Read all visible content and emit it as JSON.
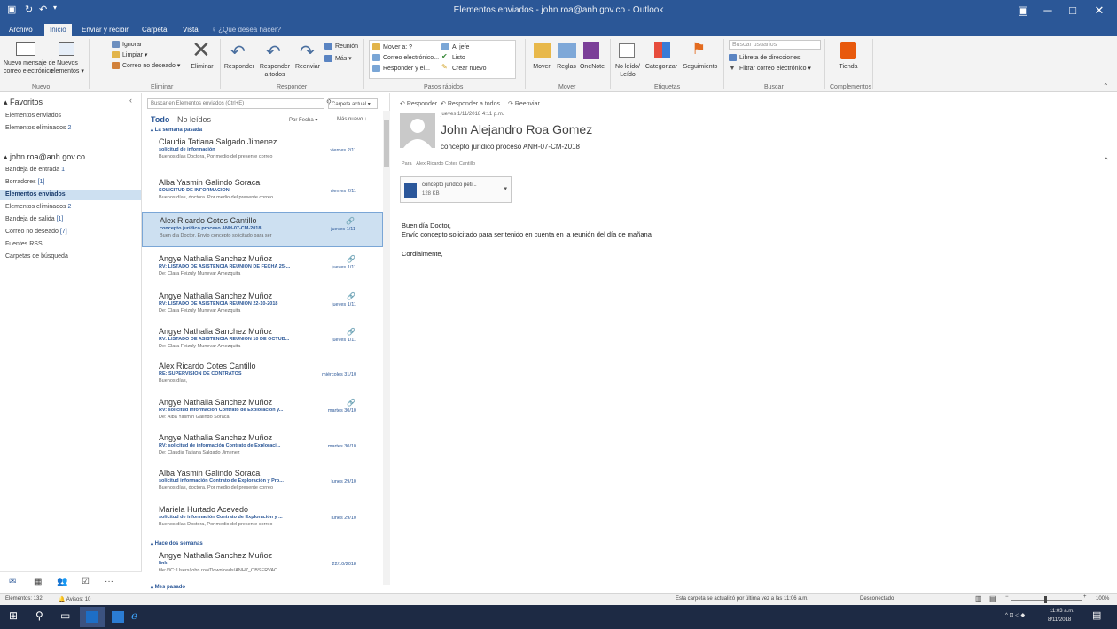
{
  "window": {
    "title": "Elementos enviados - john.roa@anh.gov.co - Outlook",
    "minimize": "─",
    "maximize": "□",
    "close": "✕",
    "restore_ribbon": "▣"
  },
  "ribbon_tabs": [
    "Archivo",
    "Inicio",
    "Enviar y recibir",
    "Carpeta",
    "Vista",
    "♀ ¿Qué desea hacer?"
  ],
  "ribbon": {
    "nuevo": {
      "new_mail": "Nuevo mensaje de\ncorreo electrónico",
      "new_items": "Nuevos\nelementos ▾",
      "group": "Nuevo"
    },
    "eliminar": {
      "ignore": "Ignorar",
      "clean": "Limpiar ▾",
      "junk": "Correo no deseado ▾",
      "delete": "Eliminar",
      "group": "Eliminar"
    },
    "responder": {
      "reply": "Responder",
      "reply_all": "Responder\na todos",
      "forward": "Reenviar",
      "meeting": "Reunión",
      "more": "Más ▾",
      "group": "Responder"
    },
    "pasos": {
      "move_to": "Mover a: ?",
      "to_boss": "Al jefe",
      "team": "Correo electrónico...",
      "done": "Listo",
      "reply_delete": "Responder y el...",
      "create_new": "Crear nuevo",
      "group": "Pasos rápidos"
    },
    "mover": {
      "move": "Mover",
      "rules": "Reglas",
      "onenote": "OneNote",
      "group": "Mover"
    },
    "etiquetas": {
      "unread": "No leído/\nLeído",
      "categorize": "Categorizar",
      "followup": "Seguimiento",
      "group": "Etiquetas"
    },
    "buscar": {
      "search_people": "Buscar usuarios",
      "address_book": "Libreta de direcciones",
      "filter": "Filtrar correo electrónico ▾",
      "group": "Buscar"
    },
    "complementos": {
      "store": "Tienda",
      "group": "Complementos"
    }
  },
  "folder_pane": {
    "favorites_header": "▴ Favoritos",
    "collapse": "‹",
    "favorites": [
      {
        "label": "Elementos enviados",
        "count": ""
      },
      {
        "label": "Elementos eliminados",
        "count": "2"
      }
    ],
    "account": "▴ john.roa@anh.gov.co",
    "folders": [
      {
        "label": "Bandeja de entrada",
        "count": "1"
      },
      {
        "label": "Borradores",
        "count": "[1]"
      },
      {
        "label": "Elementos enviados",
        "count": ""
      },
      {
        "label": "Elementos eliminados",
        "count": "2"
      },
      {
        "label": "Bandeja de salida",
        "count": "[1]"
      },
      {
        "label": "Correo no deseado",
        "count": "[7]"
      },
      {
        "label": "Fuentes RSS",
        "count": ""
      },
      {
        "label": "Carpetas de búsqueda",
        "count": ""
      }
    ]
  },
  "nav_bar": [
    "✉",
    "▦",
    "👥",
    "☑",
    "···"
  ],
  "mail_list": {
    "search_placeholder": "Buscar en Elementos enviados (Ctrl+E)",
    "search_scope": "Carpeta actual ▾",
    "filter_all": "Todo",
    "filter_unread": "No leídos",
    "sort_by": "Por Fecha ▾",
    "sort_order": "Más nuevo ↓",
    "groups": [
      "▴ La semana pasada",
      "▴ Hace dos semanas",
      "▴ Mes pasado"
    ],
    "items": [
      {
        "from": "Claudia Tatiana Salgado Jimenez",
        "subject": "solicitud de información",
        "preview": "Buenos días Doctora,  Por medio del presente correo",
        "date": "viernes 2/11",
        "clip": ""
      },
      {
        "from": "Alba Yasmin Galindo Soraca",
        "subject": "SOLICITUD DE INFORMACION",
        "preview": "Buenos días, doctora.  Por medio del presente correo",
        "date": "viernes 2/11",
        "clip": ""
      },
      {
        "from": "Alex Ricardo Cotes Cantillo",
        "subject": "concepto jurídico proceso ANH-07-CM-2018",
        "preview": "Buen día Doctor,  Envío concepto solicitado para ser",
        "date": "jueves 1/11",
        "clip": "🔗"
      },
      {
        "from": "Angye Nathalia Sanchez Muñoz",
        "subject": "RV: LISTADO DE ASISTENCIA REUNION DE FECHA 25-...",
        "preview": "De: Clara Feizuly Munevar Amezquita",
        "date": "jueves 1/11",
        "clip": "🔗"
      },
      {
        "from": "Angye Nathalia Sanchez Muñoz",
        "subject": "RV: LISTADO DE ASISTENCIA REUNION 22-10-2018",
        "preview": "De: Clara Feizuly Munevar Amezquita",
        "date": "jueves 1/11",
        "clip": "🔗"
      },
      {
        "from": "Angye Nathalia Sanchez Muñoz",
        "subject": "RV: LISTADO DE ASISTENCIA REUNION 10 DE OCTUB...",
        "preview": "De: Clara Feizuly Munevar Amezquita",
        "date": "jueves 1/11",
        "clip": "🔗"
      },
      {
        "from": "Alex Ricardo Cotes Cantillo",
        "subject": "RE: SUPERVISIÓN DE CONTRATOS",
        "preview": "Buenos días,",
        "date": "miércoles 31/10",
        "clip": ""
      },
      {
        "from": "Angye Nathalia Sanchez Muñoz",
        "subject": "RV: solicitud información Contrato de Exploración y...",
        "preview": "De: Alba Yasmin Galindo Soraca",
        "date": "martes 30/10",
        "clip": "🔗"
      },
      {
        "from": "Angye Nathalia Sanchez Muñoz",
        "subject": "RV: solicitud de información  Contrato de Exploraci...",
        "preview": "De: Claudia Tatiana Salgado Jimenez",
        "date": "martes 30/10",
        "clip": ""
      },
      {
        "from": "Alba Yasmin Galindo Soraca",
        "subject": "solicitud información Contrato de Exploración y Pro...",
        "preview": "Buenos días, doctora.  Por medio del presente correo",
        "date": "lunes 29/10",
        "clip": ""
      },
      {
        "from": "Mariela Hurtado Acevedo",
        "subject": "solicitud de información  Contrato de Exploración y ...",
        "preview": "Buenos días Doctora,  Por medio del presente correo",
        "date": "lunes 29/10",
        "clip": ""
      },
      {
        "from": "Angye Nathalia Sanchez Muñoz",
        "subject": "link",
        "preview": "file:///C:/Users/john.roa/Downloads/ANH7_OBSERVAC",
        "date": "22/10/2018",
        "clip": ""
      }
    ]
  },
  "reading_pane": {
    "actions": [
      "Responder",
      "Responder a todos",
      "Reenviar"
    ],
    "date": "jueves 1/11/2018 4:11 p.m.",
    "from": "John Alejandro Roa Gomez",
    "subject": "concepto jurídico proceso ANH-07-CM-2018",
    "to_label": "Para",
    "to": "Alex Ricardo Cotes Cantillo",
    "attachment": {
      "name": "concepto jurídico peti...",
      "size": "128 KB"
    },
    "body": [
      "Buen día Doctor,",
      "Envío concepto solicitado para ser tenido en cuenta en la reunión del día de mañana",
      "Cordialmente,"
    ]
  },
  "status_bar": {
    "items": "Elementos: 132",
    "reminders": "🔔 Avisos: 10",
    "updated": "Esta carpeta se actualizó por última vez a las 11:06 a.m.",
    "connection": "Desconectado",
    "zoom": "100%"
  },
  "taskbar": {
    "time": "11:03 a.m.",
    "date": "8/11/2018"
  },
  "colors": {
    "accent": "#2b5797",
    "selection": "#cde0f1",
    "taskbar": "#1d2a44"
  }
}
